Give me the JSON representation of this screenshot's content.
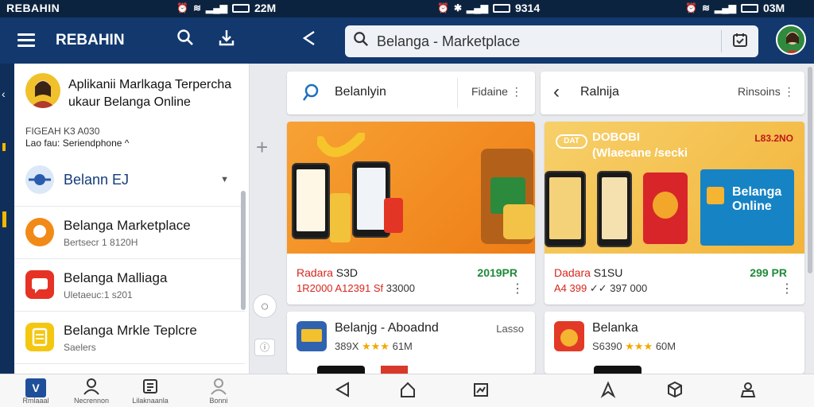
{
  "status_bar": {
    "app_name": "REBAHIN",
    "time_1": "22M",
    "time_2": "9314",
    "time_3": "03M"
  },
  "app_bar": {
    "title": "REBAHIN",
    "search_value": "Belanga - Marketplace"
  },
  "drawer": {
    "profile_line1": "Aplikanii Marlkaga Terpercha",
    "profile_line2": "ukaur Belanga Online",
    "section_line1": "FIGEAH K3 A030",
    "section_line2": "Lao fau: Seriendphone ^",
    "items": [
      {
        "title": "Belann EJ",
        "subtitle": ""
      },
      {
        "title": "Belanga Marketplace",
        "subtitle": "Bertsecr 1 8120H"
      },
      {
        "title": "Belanga Malliaga",
        "subtitle": "Uletaeuc:1 s201"
      },
      {
        "title": "Belanga  Mrkle Teplcre",
        "subtitle": "Saelers"
      }
    ]
  },
  "top_cards": {
    "left_title": "Belanlyin",
    "left_right": "Fidaine ⋮",
    "right_title": "Ralnija",
    "right_right": "Rinsoins ⋮"
  },
  "promos": [
    {
      "line1_red": "Radara",
      "line1": " S3D",
      "line2_red": "1R2000  A12391 Sf",
      "line2": " 33000",
      "price": "2019PR"
    },
    {
      "line1_red": "Dadara",
      "line1": " S1SU",
      "line2_red": "A4 399",
      "line2": "  ✓✓ 397 000",
      "price": "299 PR"
    }
  ],
  "promo_banner_2": {
    "badge": "DAT",
    "title_line1": "DOBOBI",
    "title_line2": "(Wlaecane /secki",
    "corner": "L83.2NO",
    "box_text_1": "Belanga",
    "box_text_2": "Online"
  },
  "list_cards": [
    {
      "title": "Belanjg - Aboadnd",
      "rating": "389X",
      "rating_tail": "61M",
      "right": "Lasso"
    },
    {
      "title": "Belanka",
      "rating": "S6390",
      "rating_tail": "60M",
      "right": ""
    }
  ],
  "bottom_nav": [
    {
      "label": "Rmlaaal",
      "icon": "logo-icon"
    },
    {
      "label": "Necrennon",
      "icon": "person-icon"
    },
    {
      "label": "Lilaknaanla",
      "icon": "list-icon"
    },
    {
      "label": "Bonni",
      "icon": "person-outline-icon"
    }
  ],
  "colors": {
    "appbar": "#12386e",
    "statusbar": "#0c2340",
    "accent_orange": "#f39a1e",
    "price_green": "#1f8a3a",
    "price_red": "#d7261e"
  }
}
